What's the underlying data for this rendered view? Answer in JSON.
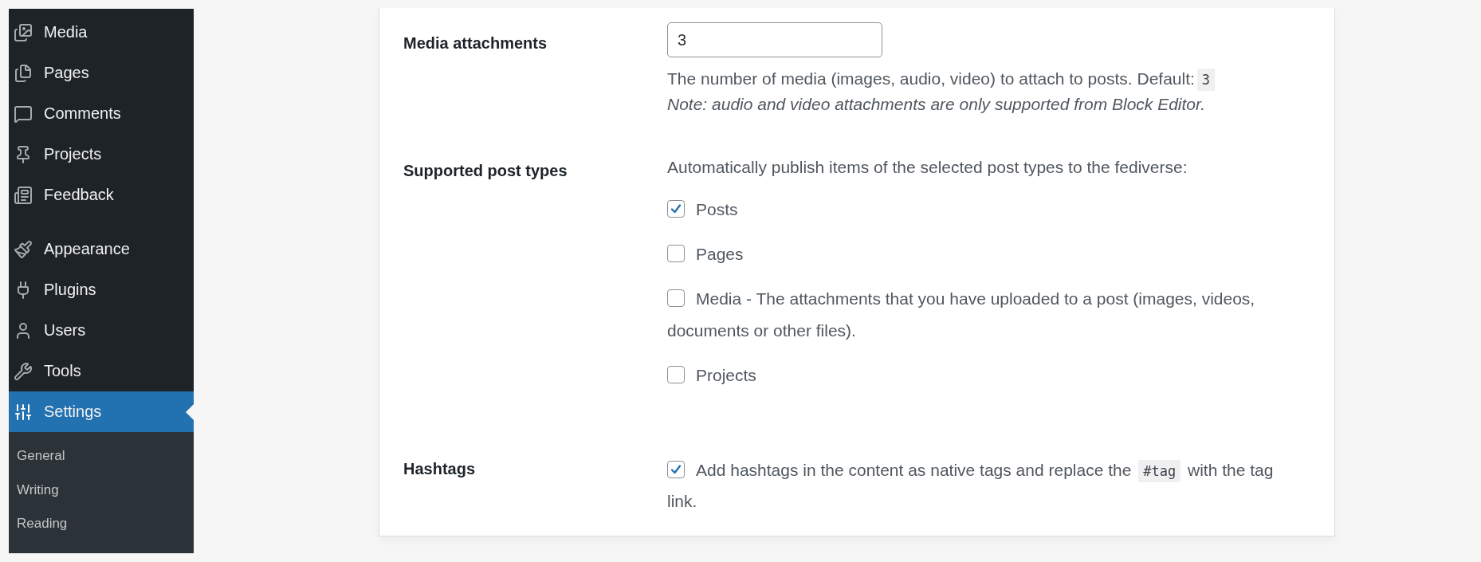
{
  "sidebar": {
    "items": [
      {
        "label": "Media",
        "selected": false
      },
      {
        "label": "Pages",
        "selected": false
      },
      {
        "label": "Comments",
        "selected": false
      },
      {
        "label": "Projects",
        "selected": false
      },
      {
        "label": "Feedback",
        "selected": false
      },
      {
        "label": "Appearance",
        "selected": false
      },
      {
        "label": "Plugins",
        "selected": false
      },
      {
        "label": "Users",
        "selected": false
      },
      {
        "label": "Tools",
        "selected": false
      },
      {
        "label": "Settings",
        "selected": true
      }
    ],
    "submenu": [
      {
        "label": "General"
      },
      {
        "label": "Writing"
      },
      {
        "label": "Reading"
      }
    ]
  },
  "settings": [
    {
      "kind": "number",
      "label": "Media attachments",
      "value": "3",
      "description": {
        "text": "The number of media (images, audio, video) to attach to posts. Default:",
        "code": "3"
      },
      "note": "Note: audio and video attachments are only supported from Block Editor."
    },
    {
      "kind": "checklist",
      "label": "Supported post types",
      "intro": "Automatically publish items of the selected post types to the fediverse:",
      "options": [
        {
          "label": "Posts",
          "checked": true
        },
        {
          "label": "Pages",
          "checked": false
        },
        {
          "label": "Media - The attachments that you have uploaded to a post (images, videos, documents or other files).",
          "checked": false
        },
        {
          "label": "Projects",
          "checked": false
        }
      ]
    },
    {
      "kind": "checkbox",
      "label": "Hashtags",
      "checked": true,
      "text_before": "Add hashtags in the content as native tags and replace the",
      "code": "#tag",
      "text_after": "with the tag link."
    }
  ]
}
